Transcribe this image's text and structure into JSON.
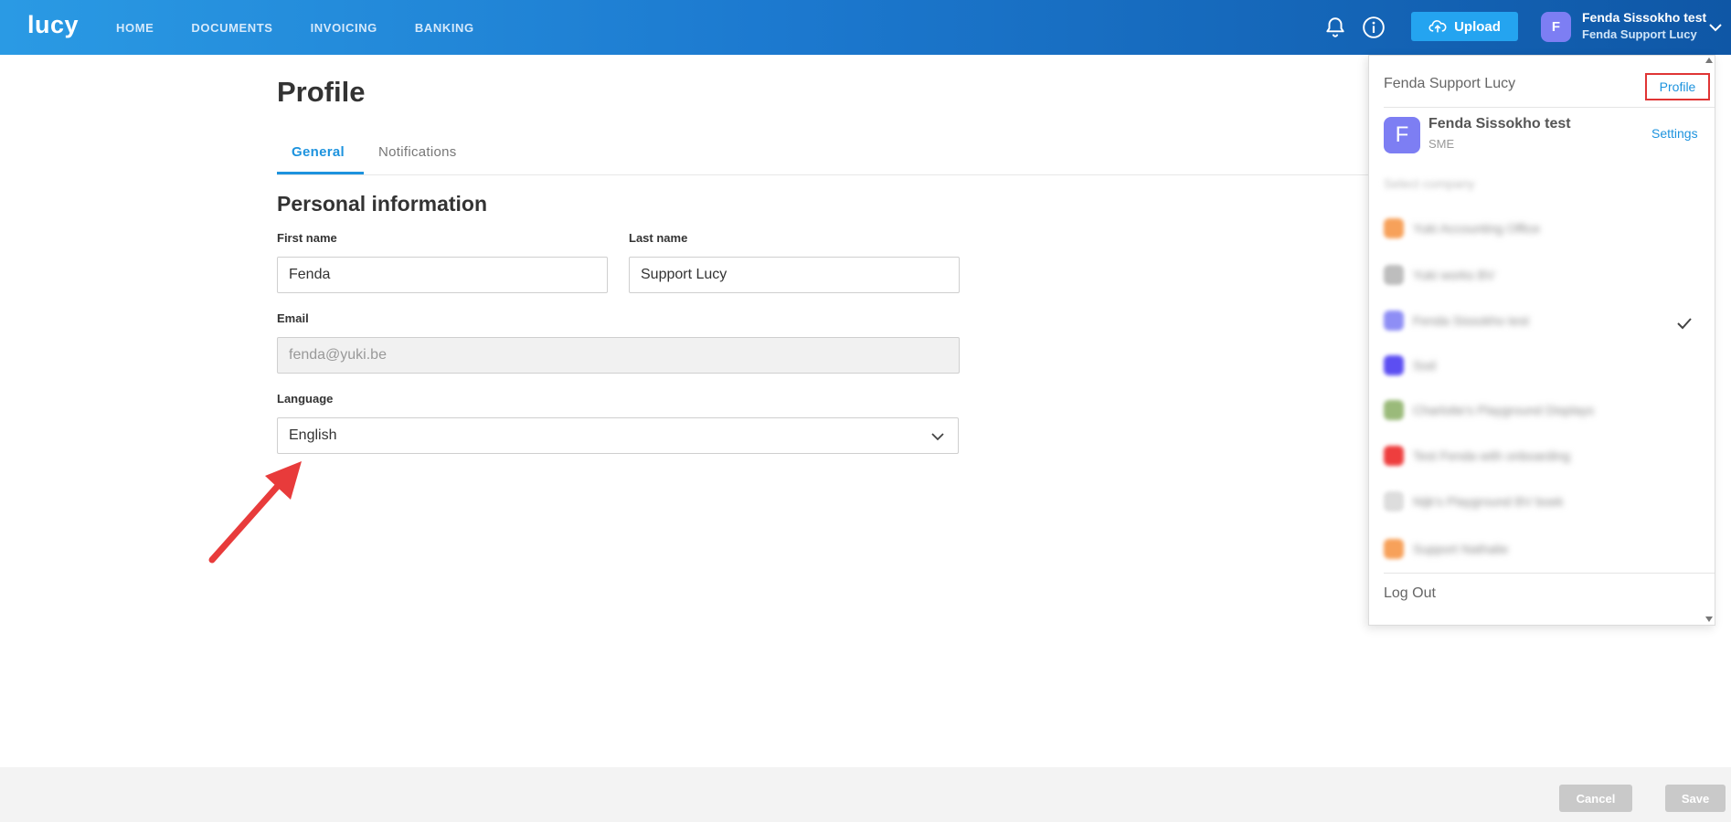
{
  "header": {
    "logo": "lucy",
    "nav": [
      "HOME",
      "DOCUMENTS",
      "INVOICING",
      "BANKING"
    ],
    "upload_label": "Upload",
    "user": {
      "avatar_letter": "F",
      "name": "Fenda Sissokho test",
      "company": "Fenda Support Lucy"
    },
    "icons": [
      "bell-icon",
      "info-icon",
      "upload-cloud-icon",
      "chevron-down-icon"
    ]
  },
  "page": {
    "title": "Profile",
    "tabs": [
      {
        "label": "General",
        "active": true
      },
      {
        "label": "Notifications",
        "active": false
      }
    ],
    "section_title": "Personal information",
    "form": {
      "first_name_label": "First name",
      "first_name_value": "Fenda",
      "last_name_label": "Last name",
      "last_name_value": "Support Lucy",
      "email_label": "Email",
      "email_value": "fenda@yuki.be",
      "language_label": "Language",
      "language_value": "English"
    }
  },
  "footer": {
    "cancel_label": "Cancel",
    "save_label": "Save"
  },
  "dropdown": {
    "header_name": "Fenda Support Lucy",
    "profile_link": "Profile",
    "current_company": {
      "avatar_letter": "F",
      "name": "Fenda Sissokho test",
      "type": "SME",
      "settings_label": "Settings"
    },
    "select_company_label": "Select company",
    "companies": [
      {
        "name": "Yuki Accounting Office",
        "color": "#f7a15a"
      },
      {
        "name": "Yuki works BV",
        "color": "#bdbdbd"
      },
      {
        "name": "Fenda Sissokho test",
        "color": "#8e8ef5"
      },
      {
        "name": "Sod",
        "color": "#5c4ef2"
      },
      {
        "name": "Charlotte's Playground Displays",
        "color": "#9aba7a"
      },
      {
        "name": "Test Fenda with onboarding",
        "color": "#ee3e3e"
      },
      {
        "name": "Nijk's Playground BV boek",
        "color": "#dddddd"
      },
      {
        "name": "Support Nathalie",
        "color": "#f7a15a"
      }
    ],
    "logout_label": "Log Out"
  },
  "colors": {
    "accent": "#1d93de",
    "topbar_start": "#2a9ae4",
    "topbar_end": "#0f57a6",
    "highlight_border": "#e03535",
    "arrow": "#e83b3b"
  }
}
